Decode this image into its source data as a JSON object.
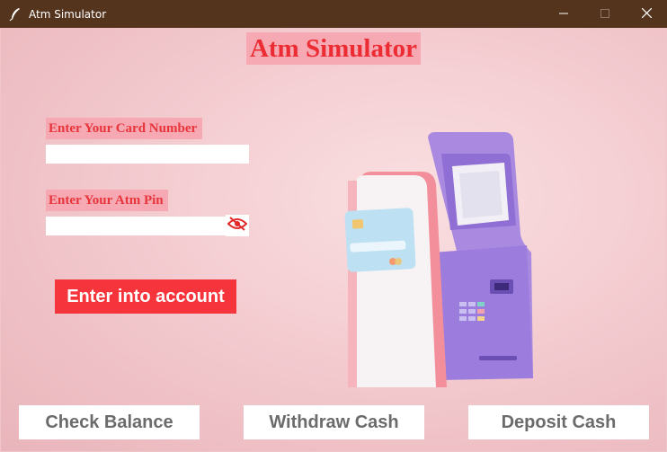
{
  "window": {
    "title": "Atm Simulator",
    "controls": [
      "minimize-icon",
      "maximize-icon",
      "close-icon"
    ]
  },
  "main": {
    "title": "Atm Simulator",
    "card_label": "Enter Your Card Number",
    "card_value": "",
    "pin_label": "Enter Your Atm Pin",
    "pin_value": "",
    "pin_toggle_icon": "eye-off-icon",
    "enter_button": "Enter into account"
  },
  "actions": {
    "check_balance": "Check Balance",
    "withdraw_cash": "Withdraw Cash",
    "deposit_cash": "Deposit Cash"
  },
  "colors": {
    "titlebar": "#55341e",
    "title_bg": "#f6a9b3",
    "title_text": "#ec2b33",
    "enter_button": "#f6343b",
    "background": "#f0c6cb"
  }
}
